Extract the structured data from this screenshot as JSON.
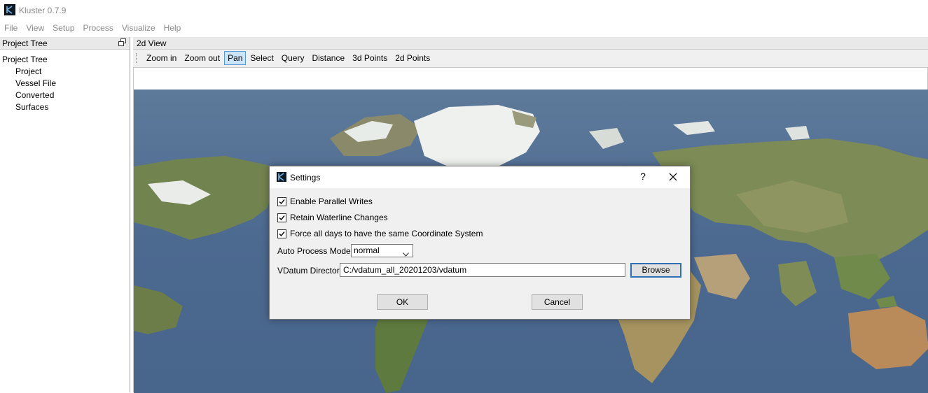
{
  "window": {
    "title": "Kluster 0.7.9"
  },
  "menu": [
    "File",
    "View",
    "Setup",
    "Process",
    "Visualize",
    "Help"
  ],
  "project_panel": {
    "title": "Project Tree",
    "root": "Project Tree",
    "children": [
      "Project",
      "Vessel File",
      "Converted",
      "Surfaces"
    ]
  },
  "view_panel": {
    "title": "2d View",
    "toolbar": [
      "Zoom in",
      "Zoom out",
      "Pan",
      "Select",
      "Query",
      "Distance",
      "3d Points",
      "2d Points"
    ],
    "active_tool": "Pan"
  },
  "settings_dialog": {
    "title": "Settings",
    "help": "?",
    "checkboxes": [
      {
        "label": "Enable Parallel Writes",
        "checked": true
      },
      {
        "label": "Retain Waterline Changes",
        "checked": true
      },
      {
        "label": "Force all days to have the same Coordinate System",
        "checked": true
      }
    ],
    "auto_process_label": "Auto Process Mode:",
    "auto_process_value": "normal",
    "vdatum_label": "VDatum Directory",
    "vdatum_value": "C:/vdatum_all_20201203/vdatum",
    "browse": "Browse",
    "ok": "OK",
    "cancel": "Cancel"
  },
  "colors": {
    "ocean": "#4f6b8f",
    "land": "#7b8a55",
    "ice": "#f2f4f2",
    "accent": "#2f6fb6",
    "active_tool_bg": "#cce4f7"
  }
}
